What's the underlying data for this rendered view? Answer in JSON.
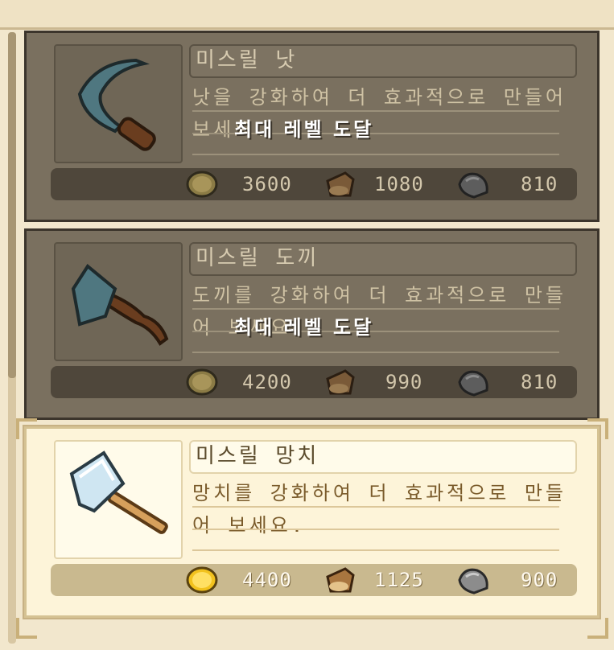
{
  "items": [
    {
      "title": "미스릴 낫",
      "description": "낫을 강화하여 더 효과적으로 만들어 보세요.",
      "status_overlay": "최대 레벨 도달",
      "state": "locked",
      "cost": {
        "gold": "3600",
        "wood": "1080",
        "stone": "810"
      }
    },
    {
      "title": "미스릴 도끼",
      "description": "도끼를 강화하여 더 효과적으로 만들어 보세요.",
      "status_overlay": "최대 레벨 도달",
      "state": "locked",
      "cost": {
        "gold": "4200",
        "wood": "990",
        "stone": "810"
      }
    },
    {
      "title": "미스릴 망치",
      "description": "망치를 강화하여 더 효과적으로 만들어 보세요.",
      "status_overlay": "",
      "state": "active",
      "cost": {
        "gold": "4400",
        "wood": "1125",
        "stone": "900"
      }
    }
  ],
  "icons": {
    "item_0": "sickle-icon",
    "item_1": "axe-icon",
    "item_2": "hammer-icon",
    "gold": "gold-coin-icon",
    "wood": "wood-log-icon",
    "stone": "stone-icon"
  },
  "colors": {
    "gold": "#f2c21e",
    "wood": "#a9763f",
    "stone": "#7b7b7b",
    "mithril": "#5f8a93",
    "hammer_head": "#cfe6f2"
  }
}
